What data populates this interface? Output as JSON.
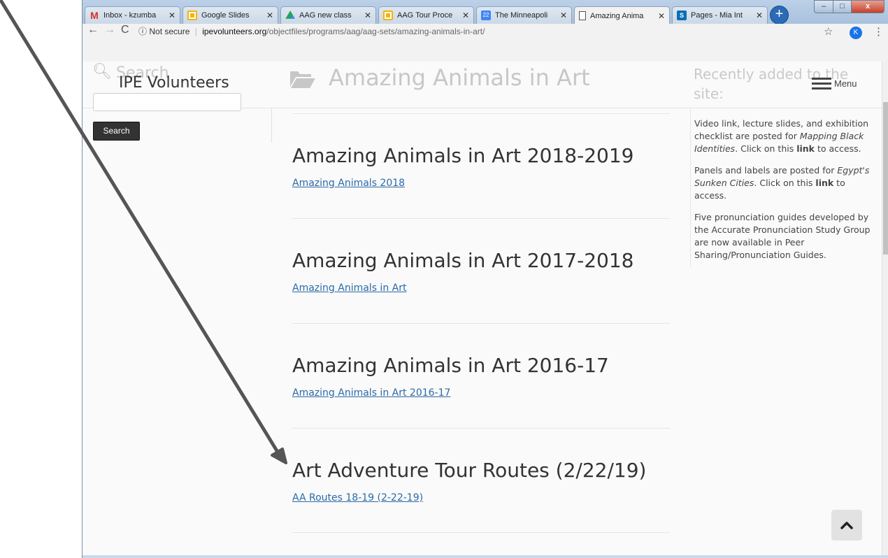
{
  "browser": {
    "tabs": [
      {
        "label": "Inbox - kzumba",
        "icon": "gmail-icon",
        "color": "#d93025"
      },
      {
        "label": "Google Slides",
        "icon": "slides-icon",
        "color": "#f4b400"
      },
      {
        "label": "AAG new class",
        "icon": "drive-icon",
        "color": "#1fa463"
      },
      {
        "label": "AAG Tour Proce",
        "icon": "slides-icon",
        "color": "#f4b400"
      },
      {
        "label": "The Minneapoli",
        "icon": "calendar-icon",
        "color": "#4285f4"
      },
      {
        "label": "Amazing Anima",
        "icon": "page-icon",
        "color": "#ffffff",
        "active": true
      },
      {
        "label": "Pages - Mia Int",
        "icon": "sharepoint-icon",
        "color": "#0b6fb5"
      }
    ],
    "close_glyph": "✕",
    "new_tab_glyph": "+",
    "security_label": "Not secure",
    "url_host": "ipevolunteers.org",
    "url_path": "/objectfiles/programs/aag/aag-sets/amazing-animals-in-art/",
    "profile_initial": "K",
    "controls": {
      "minimize": "–",
      "maximize": "□",
      "close": "x"
    }
  },
  "header": {
    "search_placeholder": "Search",
    "brand": "IPE Volunteers",
    "search_button": "Search",
    "page_title": "Amazing Animals in Art",
    "recent_title": "Recently added to the site:",
    "menu_label": "Menu"
  },
  "entries": [
    {
      "title": "Amazing Animals in Art 2018-2019",
      "link": "Amazing Animals 2018"
    },
    {
      "title": "Amazing Animals in Art 2017-2018",
      "link": "Amazing Animals in Art"
    },
    {
      "title": "Amazing Animals in Art 2016-17",
      "link": "Amazing Animals in Art 2016-17"
    },
    {
      "title": "Art Adventure Tour Routes (2/22/19)",
      "link": "AA Routes 18-19 (2-22-19)"
    }
  ],
  "sidebar": {
    "notes": [
      {
        "pre": "Video link, lecture slides, and exhibition checklist are posted for ",
        "em": "Mapping Black Identities",
        "mid": ". Click on this ",
        "strong": "link",
        "post": " to access."
      },
      {
        "pre": "Panels and labels are posted for ",
        "em": "Egypt's Sunken Cities",
        "mid": ". Click on this ",
        "strong": "link",
        "post": " to access."
      },
      {
        "pre": "Five pronunciation guides developed by the Accurate Pronunciation Study Group are now available in Peer Sharing/Pronunciation Guides.",
        "em": "",
        "mid": "",
        "strong": "",
        "post": ""
      }
    ]
  }
}
